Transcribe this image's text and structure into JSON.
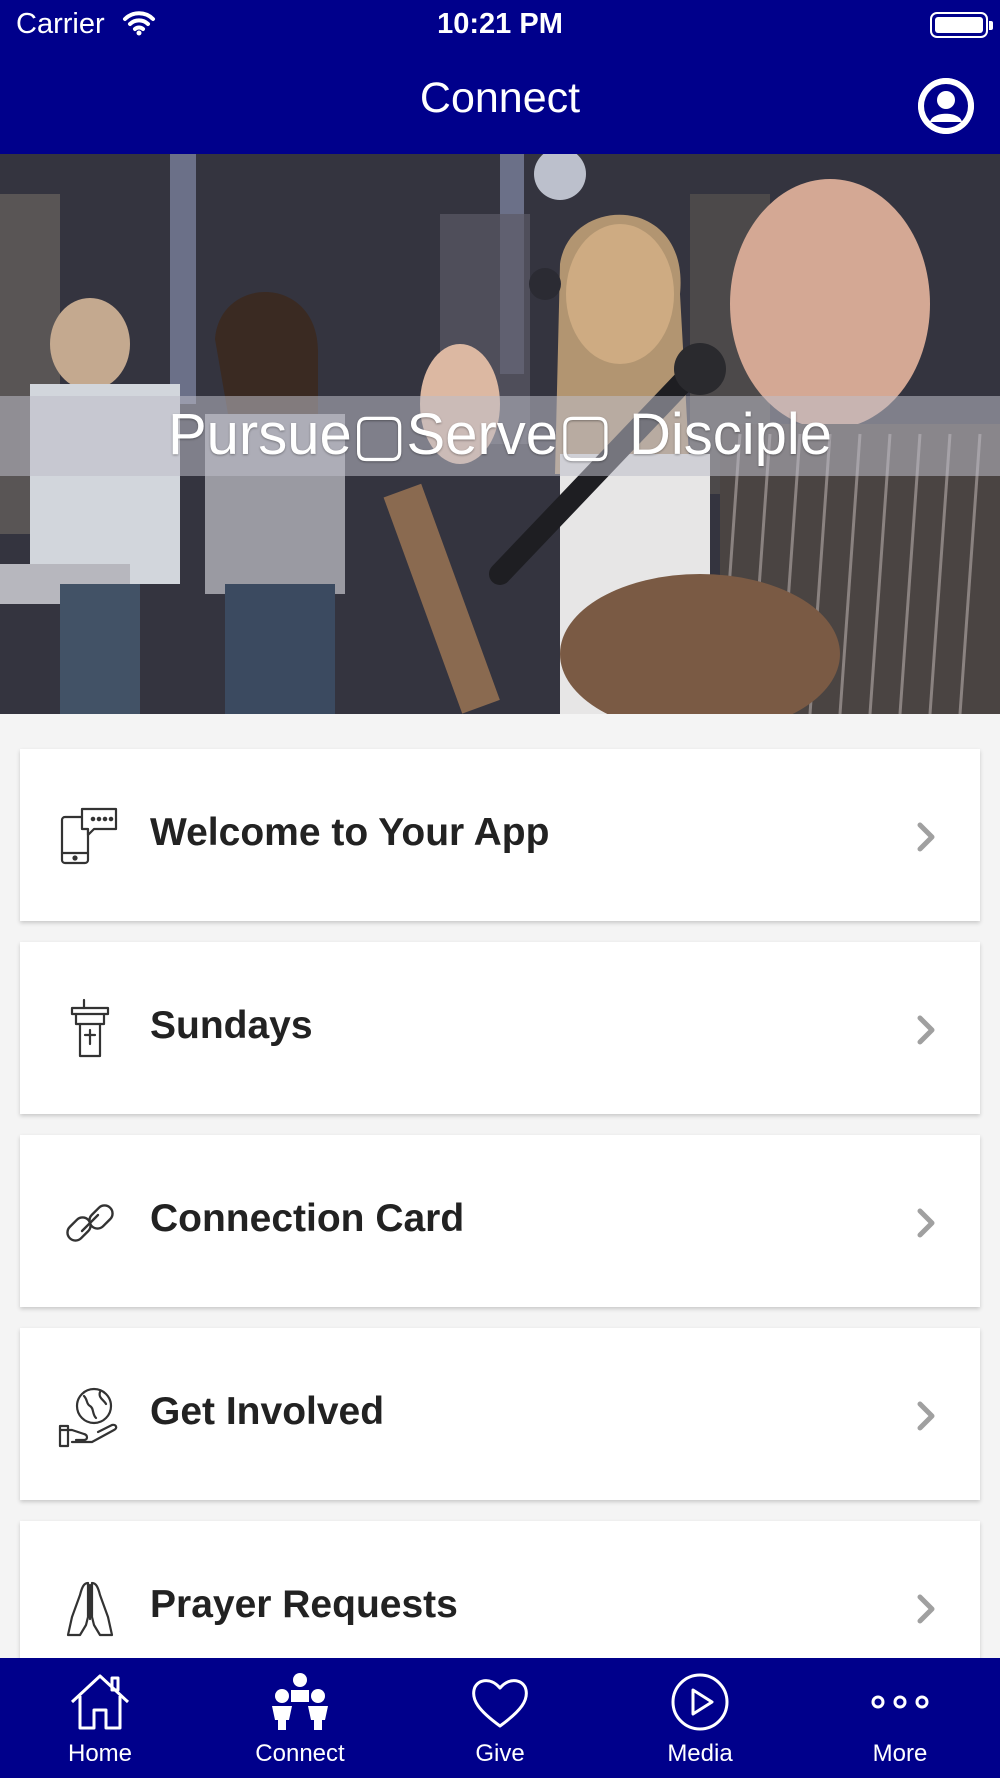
{
  "status_bar": {
    "carrier": "Carrier",
    "time": "10:21 PM"
  },
  "header": {
    "title": "Connect",
    "profile_icon": "user-circle-icon"
  },
  "hero": {
    "tagline": "Pursue▢Serve▢ Disciple"
  },
  "menu": [
    {
      "label": "Welcome to Your App",
      "icon": "phone-chat-icon"
    },
    {
      "label": "Sundays",
      "icon": "pulpit-icon"
    },
    {
      "label": "Connection Card",
      "icon": "link-icon"
    },
    {
      "label": "Get Involved",
      "icon": "globe-hand-icon"
    },
    {
      "label": "Prayer Requests",
      "icon": "praying-hands-icon"
    }
  ],
  "tabbar": [
    {
      "label": "Home",
      "icon": "home-icon"
    },
    {
      "label": "Connect",
      "icon": "people-icon"
    },
    {
      "label": "Give",
      "icon": "heart-icon"
    },
    {
      "label": "Media",
      "icon": "play-circle-icon"
    },
    {
      "label": "More",
      "icon": "more-dots-icon"
    }
  ],
  "colors": {
    "primary": "#00008b",
    "background": "#f4f4f4",
    "card": "#ffffff",
    "text": "#222222"
  }
}
